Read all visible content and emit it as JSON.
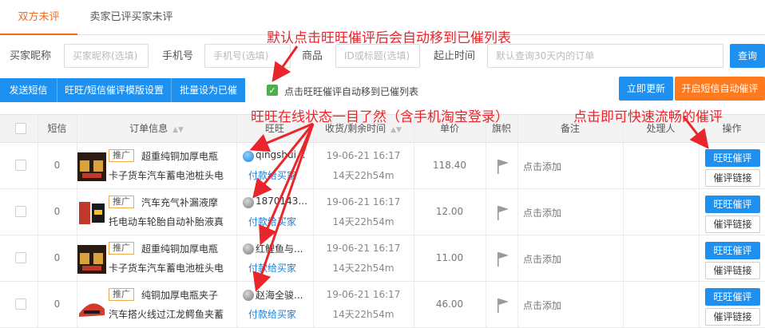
{
  "tabs": [
    {
      "label": "双方未评",
      "active": true
    },
    {
      "label": "卖家已评买家未评",
      "active": false
    }
  ],
  "filters": {
    "buyer_label": "买家昵称",
    "buyer_placeholder": "买家昵称(选填)",
    "phone_label": "手机号",
    "phone_placeholder": "手机号(选填)",
    "product_label": "商品",
    "product_placeholder": "ID或标题(选填)",
    "date_label": "起止时间",
    "date_placeholder": "默认查询30天内的订单",
    "query_label": "查询"
  },
  "toolbar": {
    "send_sms": "发送短信",
    "template_settings": "旺旺/短信催评模版设置",
    "batch_mark": "批量设为已催",
    "auto_move_text": "点击旺旺催评自动移到已催列表",
    "auto_move_checked": true,
    "refresh_now": "立即更新",
    "enable_sms_auto": "开启短信自动催评"
  },
  "columns": [
    "短信",
    "订单信息",
    "旺旺",
    "收货/剩余时间",
    "单价",
    "旗帜",
    "备注",
    "处理人",
    "操作"
  ],
  "rows": [
    {
      "sms": "0",
      "promo": "推广",
      "title_line1": "超重纯铜加厚电瓶",
      "title_line2": "卡子货车汽车蓄电池桩头电",
      "ww_status": "online",
      "nick": "qingshui...",
      "pay_status": "付款给买家",
      "date": "19-06-21 16:17",
      "remaining": "14天22h54m",
      "price": "118.40",
      "note": "点击添加",
      "action_primary": "旺旺催评",
      "action_secondary": "催评链接"
    },
    {
      "sms": "0",
      "promo": "推广",
      "title_line1": "汽车充气补漏液摩",
      "title_line2": "托电动车轮胎自动补胎液真",
      "ww_status": "offline",
      "nick": "1870143...",
      "pay_status": "付款给买家",
      "date": "19-06-21 16:17",
      "remaining": "14天22h54m",
      "price": "12.00",
      "note": "点击添加",
      "action_primary": "旺旺催评",
      "action_secondary": "催评链接"
    },
    {
      "sms": "0",
      "promo": "推广",
      "title_line1": "超重纯铜加厚电瓶",
      "title_line2": "卡子货车汽车蓄电池桩头电",
      "ww_status": "offline",
      "nick": "红鲤鱼与...",
      "pay_status": "付款给买家",
      "date": "19-06-21 16:17",
      "remaining": "14天22h54m",
      "price": "11.00",
      "note": "点击添加",
      "action_primary": "旺旺催评",
      "action_secondary": "催评链接"
    },
    {
      "sms": "0",
      "promo": "推广",
      "title_line1": "纯铜加厚电瓶夹子",
      "title_line2": "汽车搭火线过江龙鳄鱼夹蓄",
      "ww_status": "offline",
      "nick": "赵海全骏...",
      "pay_status": "付款给买家",
      "date": "19-06-21 16:17",
      "remaining": "14天22h54m",
      "price": "46.00",
      "note": "点击添加",
      "action_primary": "旺旺催评",
      "action_secondary": "催评链接"
    }
  ],
  "annotations": {
    "top": "默认点击旺旺催评后会自动移到已催列表",
    "middle": "旺旺在线状态一目了然（含手机淘宝登录）",
    "right": "点击即可快速流畅的催评"
  },
  "colors": {
    "accent": "#ef6b22",
    "primary": "#1e90f0",
    "orange_button": "#ff7a1e",
    "annotation": "#e8262b",
    "checkbox_on": "#4db04e"
  }
}
